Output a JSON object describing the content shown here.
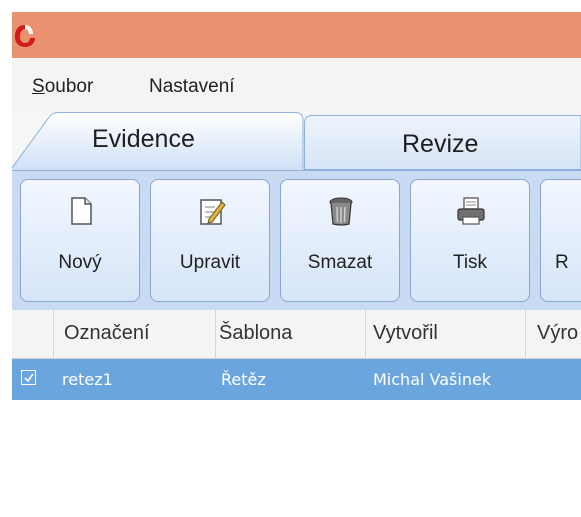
{
  "colors": {
    "titlebar": "#ea9170",
    "toolbar": "#c9dbf3",
    "selected_row": "#6aa6dd"
  },
  "menu": {
    "soubor_first": "S",
    "soubor_rest": "oubor",
    "nastaveni": "Nastavení"
  },
  "tabs": {
    "evidence": "Evidence",
    "revize": "Revize"
  },
  "toolbar": {
    "new": "Nový",
    "edit": "Upravit",
    "delete": "Smazat",
    "print": "Tisk",
    "cut": "R"
  },
  "table": {
    "headers": {
      "oznaceni": "Označení",
      "sablona": "Šablona",
      "vytvoril": "Vytvořil",
      "vyrobce": "Výro"
    },
    "rows": [
      {
        "checked": true,
        "oznaceni": "retez1",
        "sablona": "Řetěz",
        "vytvoril": "Michal Vašinek"
      }
    ]
  }
}
